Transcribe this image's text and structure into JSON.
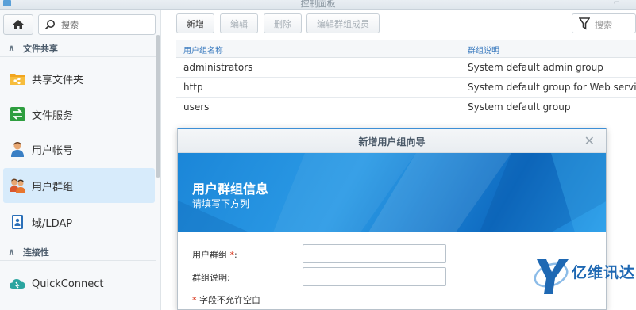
{
  "window": {
    "title": "控制面板"
  },
  "sidebar": {
    "search_placeholder": "搜索",
    "sections": [
      {
        "label": "文件共享"
      },
      {
        "label": "连接性"
      }
    ],
    "items": [
      {
        "label": "共享文件夹",
        "icon": "shared-folder-icon"
      },
      {
        "label": "文件服务",
        "icon": "file-services-icon"
      },
      {
        "label": "用户帐号",
        "icon": "user-icon"
      },
      {
        "label": "用户群组",
        "icon": "user-group-icon",
        "active": true
      },
      {
        "label": "域/LDAP",
        "icon": "domain-ldap-icon"
      },
      {
        "label": "QuickConnect",
        "icon": "quickconnect-icon"
      }
    ]
  },
  "toolbar": {
    "create": "新增",
    "edit": "编辑",
    "delete": "删除",
    "edit_members": "编辑群组成员",
    "filter_placeholder": "搜索"
  },
  "table": {
    "columns": [
      "用户组名称",
      "群组说明"
    ],
    "rows": [
      {
        "name": "administrators",
        "desc": "System default admin group"
      },
      {
        "name": "http",
        "desc": "System default group for Web services"
      },
      {
        "name": "users",
        "desc": "System default group"
      }
    ]
  },
  "dialog": {
    "title": "新增用户组向导",
    "banner_title": "用户群组信息",
    "banner_subtitle": "请填写下方列",
    "group_label": "用户群组",
    "group_required": "*",
    "group_suffix": ":",
    "desc_label": "群组说明:",
    "group_value": "",
    "desc_value": "",
    "note_star": "*",
    "note": "字段不允许空白"
  },
  "watermark": {
    "text": "亿维讯达"
  },
  "colors": {
    "accent": "#3d8fd6",
    "active_bg": "#d7ebfb",
    "required": "#d9381e"
  }
}
